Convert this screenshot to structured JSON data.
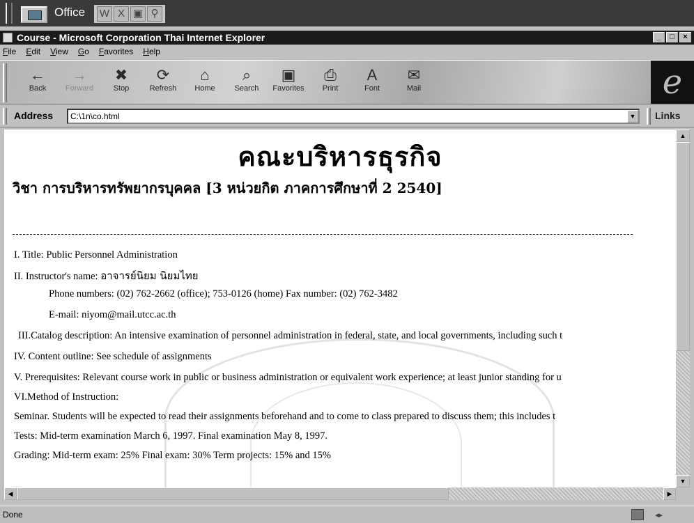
{
  "office_bar": {
    "title": "Office",
    "tool_icons": [
      "word-icon",
      "excel-icon",
      "powerpoint-icon",
      "access-icon"
    ]
  },
  "window": {
    "title": "Course - Microsoft Corporation Thai Internet Explorer"
  },
  "menu": [
    "File",
    "Edit",
    "View",
    "Go",
    "Favorites",
    "Help"
  ],
  "toolbar": {
    "buttons": [
      {
        "label": "Back",
        "icon": "←"
      },
      {
        "label": "Forward",
        "icon": "→"
      },
      {
        "label": "Stop",
        "icon": "✖"
      },
      {
        "label": "Refresh",
        "icon": "⟳"
      },
      {
        "label": "Home",
        "icon": "⌂"
      },
      {
        "label": "Search",
        "icon": "⌕"
      },
      {
        "label": "Favorites",
        "icon": "▣"
      },
      {
        "label": "Print",
        "icon": "⎙"
      },
      {
        "label": "Font",
        "icon": "A"
      },
      {
        "label": "Mail",
        "icon": "✉"
      }
    ]
  },
  "address": {
    "label": "Address",
    "value": "C:\\1n\\co.html",
    "links_label": "Links"
  },
  "page": {
    "heading": "คณะบริหารธุรกิจ",
    "subheading": "วิชา การบริหารทรัพยากรบุคคล [3 หน่วยกิต ภาคการศึกษาที่ 2 2540]",
    "title_line": "I. Title:  Public Personnel Administration",
    "instructor_label": "II.  Instructor's name: ",
    "instructor_name": "อาจารย์นิยม นิยมไทย",
    "phone_line": "Phone numbers:  (02) 762-2662 (office); 753-0126 (home) Fax number:  (02) 762-3482",
    "email_line": "E-mail:  niyom@mail.utcc.ac.th",
    "catalog_line": "III.Catalog description:  An intensive examination of personnel administration in federal, state, and local governments, including such t",
    "content_line": "IV.  Content outline:  See schedule of assignments",
    "prereq_line": "V.  Prerequisites:  Relevant course work in public or business administration or equivalent work experience; at least junior standing for u",
    "method_line": "VI.Method of Instruction:",
    "seminar_line": "Seminar.  Students will be expected to read their assignments beforehand and to come to class prepared to discuss them;  this includes t",
    "tests_line": "Tests: Mid-term examination March 6, 1997. Final examination May 8, 1997.",
    "grading_line": "Grading: Mid-term exam:  25% Final exam:  30%  Term projects:  15% and 15%"
  },
  "status": {
    "text": "Done"
  }
}
